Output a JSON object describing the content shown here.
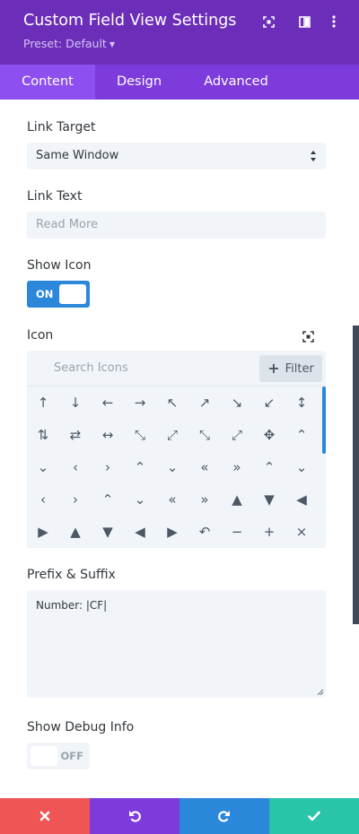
{
  "header": {
    "title": "Custom Field View Settings",
    "preset": "Preset: Default",
    "icons": [
      "fullscreen-icon",
      "sidebar-icon",
      "more-icon"
    ]
  },
  "tabs": [
    {
      "label": "Content",
      "active": true
    },
    {
      "label": "Design",
      "active": false
    },
    {
      "label": "Advanced",
      "active": false
    }
  ],
  "fields": {
    "link_target_label": "Link Target",
    "link_target_value": "Same Window",
    "link_text_label": "Link Text",
    "link_text_placeholder": "Read More",
    "show_icon_label": "Show Icon",
    "show_icon_state": "ON",
    "icon_label": "Icon",
    "icon_search_placeholder": "Search Icons",
    "filter_label": "Filter",
    "prefix_suffix_label": "Prefix & Suffix",
    "prefix_suffix_value": "Number: |CF|",
    "show_debug_label": "Show Debug Info",
    "show_debug_state": "OFF"
  },
  "icon_grid": [
    [
      "↑",
      "↓",
      "←",
      "→",
      "↖",
      "↗",
      "↘",
      "↙",
      "↕"
    ],
    [
      "⇅",
      "⇄",
      "↔",
      "⤡",
      "⤢",
      "⤡",
      "⤢",
      "✥",
      "⌃"
    ],
    [
      "⌄",
      "‹",
      "›",
      "⌃",
      "⌄",
      "«",
      "»",
      "⌃",
      "⌄"
    ],
    [
      "‹",
      "›",
      "⌃",
      "⌄",
      "«",
      "»",
      "▲",
      "▼",
      "◀"
    ],
    [
      "▶",
      "▲",
      "▼",
      "◀",
      "▶",
      "↶",
      "−",
      "+",
      "×"
    ]
  ],
  "footer": [
    "discard-icon",
    "undo-icon",
    "redo-icon",
    "save-icon"
  ],
  "colors": {
    "header": "#6c2eb9",
    "tabs": "#7d3bdb",
    "active_tab": "#8e4ff0",
    "accent_blue": "#2b87da",
    "discard": "#ef5555",
    "undo": "#7d3bdb",
    "redo": "#2b87da",
    "save": "#29c4a9"
  }
}
